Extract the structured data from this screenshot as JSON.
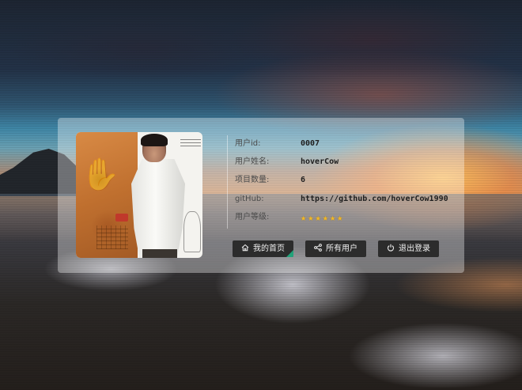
{
  "profile": {
    "rows": [
      {
        "label": "用户id:",
        "value": "0007"
      },
      {
        "label": "用户姓名:",
        "value": "hoverCow"
      },
      {
        "label": "项目数量:",
        "value": "6"
      },
      {
        "label": "gitHub:",
        "value": "https://github.com/hoverCow1990"
      },
      {
        "label": "用户等级:"
      }
    ],
    "level_stars": 6,
    "star_color": "#f2b824"
  },
  "buttons": {
    "home": {
      "label": "我的首页",
      "icon": "home-icon",
      "active": true
    },
    "all_users": {
      "label": "所有用户",
      "icon": "share-icon"
    },
    "logout": {
      "label": "退出登录",
      "icon": "power-icon"
    }
  },
  "colors": {
    "button_bg": "#2c2c2c",
    "active_corner": "#22a37a",
    "card_bg": "rgba(255,255,255,0.35)"
  }
}
